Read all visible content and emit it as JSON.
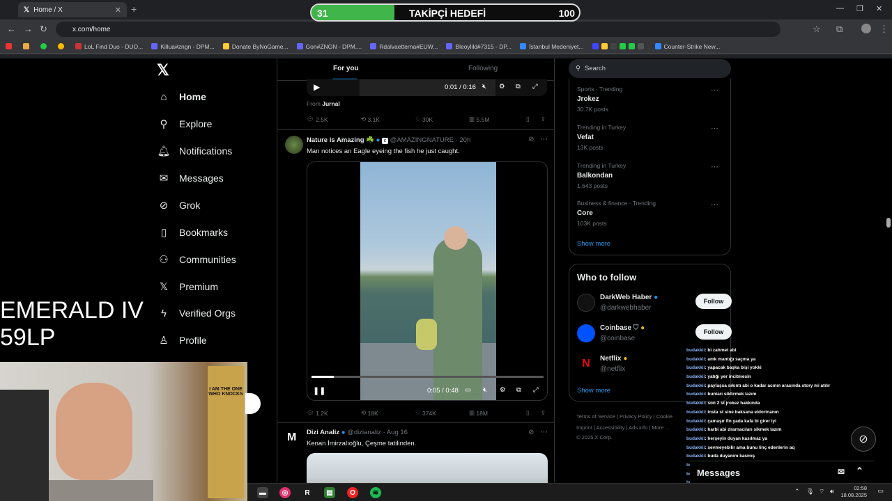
{
  "browser": {
    "tab_title": "Home / X",
    "url": "x.com/home",
    "bookmarks": [
      "LoL Find Duo - DUO...",
      "Killua#zngn - DPM...",
      "Donate ByNoGame...",
      "Gon#ZNGN - DPM....",
      "Rdalvaetterna#EUW...",
      "Bleoylild#7315 - DP...",
      "İstanbul Medeniyet...",
      "Counter-Strike New..."
    ]
  },
  "overlay": {
    "current": "31",
    "title": "TAKİPÇİ HEDEFİ",
    "goal": "100",
    "progress": 0.31
  },
  "nav": {
    "home": "Home",
    "explore": "Explore",
    "notifications": "Notifications",
    "messages": "Messages",
    "grok": "Grok",
    "bookmarks": "Bookmarks",
    "communities": "Communities",
    "premium": "Premium",
    "verified_orgs": "Verified Orgs",
    "profile": "Profile"
  },
  "timeline": {
    "tab_for_you": "For you",
    "tab_following": "Following",
    "prev_video_time": "0:01 / 0:16",
    "from_label": "From",
    "from_source": "Jurnal",
    "prev_actions": {
      "replies": "2.5K",
      "reposts": "3.1K",
      "likes": "30K",
      "views": "5.5M"
    },
    "post1": {
      "name": "Nature is Amazing ☘️",
      "handle": "@AMAZINGNATURE",
      "time": "· 20h",
      "text": "Man notices an Eagle eyeing the fish he just caught.",
      "video_time": "0:05 / 0:48",
      "actions": {
        "replies": "1.2K",
        "reposts": "18K",
        "likes": "374K",
        "views": "18M"
      }
    },
    "post2": {
      "name": "Dizi Analiz",
      "handle": "@dizianaliz",
      "time": "· Aug 16",
      "text": "Kenan İmirzalıoğlu, Çeşme tatilinden."
    }
  },
  "sidebar": {
    "search_placeholder": "Search",
    "trends": [
      {
        "meta": "Sports · Trending",
        "name": "Jrokez",
        "posts": "30.7K posts"
      },
      {
        "meta": "Trending in Turkey",
        "name": "Vefat",
        "posts": "13K posts"
      },
      {
        "meta": "Trending in Turkey",
        "name": "Balkondan",
        "posts": "1,643 posts"
      },
      {
        "meta": "Business & finance · Trending",
        "name": "Core",
        "posts": "103K posts"
      }
    ],
    "show_more": "Show more",
    "who_to_follow": "Who to follow",
    "accounts": [
      {
        "name": "DarkWeb Haber",
        "handle": "@darkwebhaber",
        "btn": "Follow"
      },
      {
        "name": "Coinbase",
        "handle": "@coinbase",
        "btn": "Follow"
      },
      {
        "name": "Netflix",
        "handle": "@netflix"
      }
    ],
    "show_more_2": "Show more",
    "footer1": "Terms of Service   |   Privacy Policy   |   Cookie",
    "footer2": "Imprint   |   Accessibility   |   Ads info   |   More ...",
    "footer3": "© 2025 X Corp.",
    "messages_label": "Messages"
  },
  "stream": {
    "rank_line1": "EMERALD IV",
    "rank_line2": "59LP",
    "poster_text": "I AM THE ONE WHO KNOCKS"
  },
  "chat": [
    {
      "u": "budakkii",
      "m": ": bi zahmet abi"
    },
    {
      "u": "budakkii",
      "m": ": amk mantığı saçma ya"
    },
    {
      "u": "budakkii",
      "m": ": yapacak başka bişi yokki"
    },
    {
      "u": "budakkii",
      "m": ": yatığı yer incitmesin"
    },
    {
      "u": "budakkii",
      "m": ": paylaşsa sıkıntı abi o kadar acının arasında story mi atılır"
    },
    {
      "u": "budakkii",
      "m": ": bunları siktirmek lazım"
    },
    {
      "u": "budakkii",
      "m": ": son 2 st jrokez hakkında"
    },
    {
      "u": "budakkii",
      "m": ": insta st sine baksana eldorinanın"
    },
    {
      "u": "budakkii",
      "m": ": çamaşır fin yada kafa bi girer iyi"
    },
    {
      "u": "budakkii",
      "m": ": harbi abi drarnacıları sikmek lazım"
    },
    {
      "u": "budakkii",
      "m": ": herşeyin duyan kasılmaz ya"
    },
    {
      "u": "budakkii",
      "m": ": sevmeyebilir ama bunu linç edenlerin aq"
    },
    {
      "u": "budakkii",
      "m": ": buda duyanını kasmış"
    },
    {
      "u": "budakkii",
      "m": ": testo intihar haberlerinde vardı"
    },
    {
      "u": "budakkii",
      "m": ": one çok bakamadınım ama"
    },
    {
      "u": "huuuxd",
      "m": ": oynaYarak atlayabilirsin"
    },
    {
      "u": "yeizzz",
      "m": ": heloo"
    }
  ],
  "taskbar": {
    "time": "02:58",
    "date": "18.08.2025"
  },
  "colors": {
    "accent": "#1d9bf0",
    "overlay_green": "#3fb54a",
    "bg": "#000000"
  }
}
